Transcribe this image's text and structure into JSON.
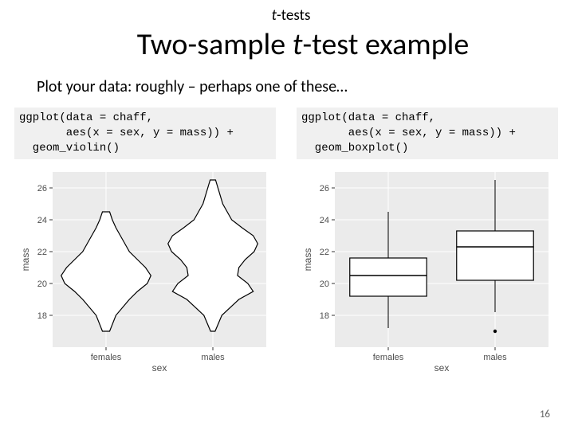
{
  "topic_italic": "t",
  "topic_rest": "-tests",
  "title_pre": "Two-sample ",
  "title_italic": "t",
  "title_post": "-test example",
  "subtitle": "Plot your data: roughly – perhaps one of these…",
  "left": {
    "code": "ggplot(data = chaff,\n       aes(x = sex, y = mass)) +\n  geom_violin()"
  },
  "right": {
    "code": "ggplot(data = chaff,\n       aes(x = sex, y = mass)) +\n  geom_boxplot()"
  },
  "chart_data": [
    {
      "type": "violin",
      "title": "",
      "xlabel": "sex",
      "ylabel": "mass",
      "categories": [
        "females",
        "males"
      ],
      "ylim": [
        16,
        27
      ],
      "yticks": [
        18,
        20,
        22,
        24,
        26
      ],
      "series": [
        {
          "name": "females",
          "shape_ranges": [
            [
              17.0,
              0.08
            ],
            [
              18.0,
              0.22
            ],
            [
              19.0,
              0.52
            ],
            [
              19.5,
              0.7
            ],
            [
              20.0,
              0.92
            ],
            [
              20.5,
              1.0
            ],
            [
              21.0,
              0.88
            ],
            [
              21.5,
              0.7
            ],
            [
              22.0,
              0.52
            ],
            [
              22.5,
              0.42
            ],
            [
              23.0,
              0.32
            ],
            [
              23.5,
              0.22
            ],
            [
              24.0,
              0.14
            ],
            [
              24.5,
              0.08
            ]
          ]
        },
        {
          "name": "males",
          "shape_ranges": [
            [
              17.0,
              0.05
            ],
            [
              18.0,
              0.2
            ],
            [
              19.0,
              0.58
            ],
            [
              19.5,
              0.9
            ],
            [
              20.0,
              0.78
            ],
            [
              20.5,
              0.55
            ],
            [
              21.0,
              0.58
            ],
            [
              21.5,
              0.72
            ],
            [
              22.0,
              0.92
            ],
            [
              22.5,
              1.0
            ],
            [
              23.0,
              0.9
            ],
            [
              23.5,
              0.65
            ],
            [
              24.0,
              0.42
            ],
            [
              25.0,
              0.22
            ],
            [
              26.5,
              0.06
            ]
          ]
        }
      ]
    },
    {
      "type": "boxplot",
      "title": "",
      "xlabel": "sex",
      "ylabel": "mass",
      "categories": [
        "females",
        "males"
      ],
      "ylim": [
        16,
        27
      ],
      "yticks": [
        18,
        20,
        22,
        24,
        26
      ],
      "series": [
        {
          "name": "females",
          "min": 17.2,
          "q1": 19.2,
          "median": 20.5,
          "q3": 21.6,
          "max": 24.5,
          "outliers": []
        },
        {
          "name": "males",
          "min": 18.2,
          "q1": 20.2,
          "median": 22.3,
          "q3": 23.3,
          "max": 26.5,
          "outliers": [
            17.0
          ]
        }
      ]
    }
  ],
  "page_number": "16"
}
